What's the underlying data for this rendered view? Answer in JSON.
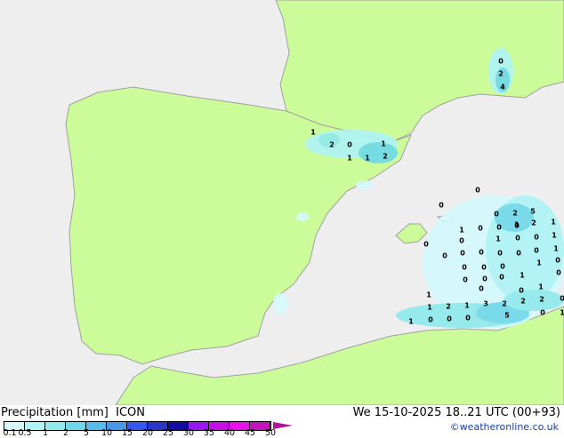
{
  "legend": {
    "title": "Precipitation [mm]",
    "model": "ICON",
    "datetime": "We 15-10-2025 18..21 UTC (00+93)",
    "credit": "©weatheronline.co.uk",
    "ticks": [
      "0.1",
      "0.5",
      "1",
      "2",
      "5",
      "10",
      "15",
      "20",
      "25",
      "30",
      "35",
      "40",
      "45",
      "50"
    ],
    "colors": [
      "#d4fafc",
      "#aef4f6",
      "#8eeaec",
      "#6ed8ea",
      "#56bcea",
      "#4a98e8",
      "#3458f0",
      "#2a36c8",
      "#140aa4",
      "#9a16f2",
      "#c410e6",
      "#ea10ec",
      "#c414be"
    ]
  },
  "colors": {
    "sea": "#eeeeee",
    "land": "#ccfc9a",
    "border": "#a0a0a0"
  },
  "map_labels": [
    "1",
    "2",
    "0",
    "1",
    "1",
    "1",
    "2",
    "0",
    "2",
    "4",
    "0",
    "0",
    "0",
    "2",
    "5",
    "1",
    "2",
    "1",
    "1",
    "0",
    "0",
    "0",
    "1",
    "0",
    "1",
    "0",
    "0",
    "0",
    "0",
    "0",
    "0",
    "1",
    "0",
    "0",
    "0",
    "0",
    "0",
    "0",
    "1",
    "0",
    "0",
    "0",
    "1",
    "0",
    "0",
    "0",
    "0",
    "1",
    "2",
    "2",
    "2",
    "0",
    "1",
    "1",
    "2",
    "1",
    "3",
    "5",
    "0",
    "1",
    "1",
    "0",
    "0",
    "0"
  ]
}
